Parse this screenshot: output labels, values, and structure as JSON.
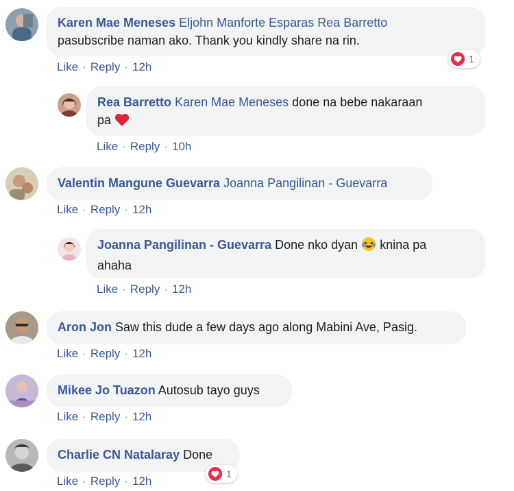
{
  "actions": {
    "like": "Like",
    "reply": "Reply",
    "sep": "·"
  },
  "comments": [
    {
      "author": "Karen Mae Meneses",
      "tags": "Eljohn Manforte Esparas Rea Barretto",
      "text": "pasubscribe naman ako. Thank you kindly share na rin.",
      "time": "12h",
      "reaction_count": "1"
    },
    {
      "author": "Rea Barretto",
      "tags": "Karen Mae Meneses",
      "text_before": "done na bebe nakaraan",
      "text_after": "pa",
      "emoji": "red-heart",
      "time": "10h"
    },
    {
      "author": "Valentin Mangune Guevarra",
      "tags": "Joanna Pangilinan - Guevarra",
      "time": "12h"
    },
    {
      "author": "Joanna Pangilinan - Guevarra",
      "text_before": "Done nko dyan",
      "text_after": "knina pa",
      "text_line2": "ahaha",
      "emoji": "laughing-tears",
      "time": "12h"
    },
    {
      "author": "Aron Jon",
      "text": "Saw this dude a few days ago along Mabini Ave, Pasig.",
      "time": "12h"
    },
    {
      "author": "Mikee Jo Tuazon",
      "text": "Autosub tayo guys",
      "time": "12h"
    },
    {
      "author": "Charlie CN Natalaray",
      "text": "Done",
      "time": "12h",
      "reaction_count": "1"
    }
  ],
  "colors": {
    "link": "#385898",
    "bubble": "#f2f3f5",
    "heart": "#f0284a"
  }
}
